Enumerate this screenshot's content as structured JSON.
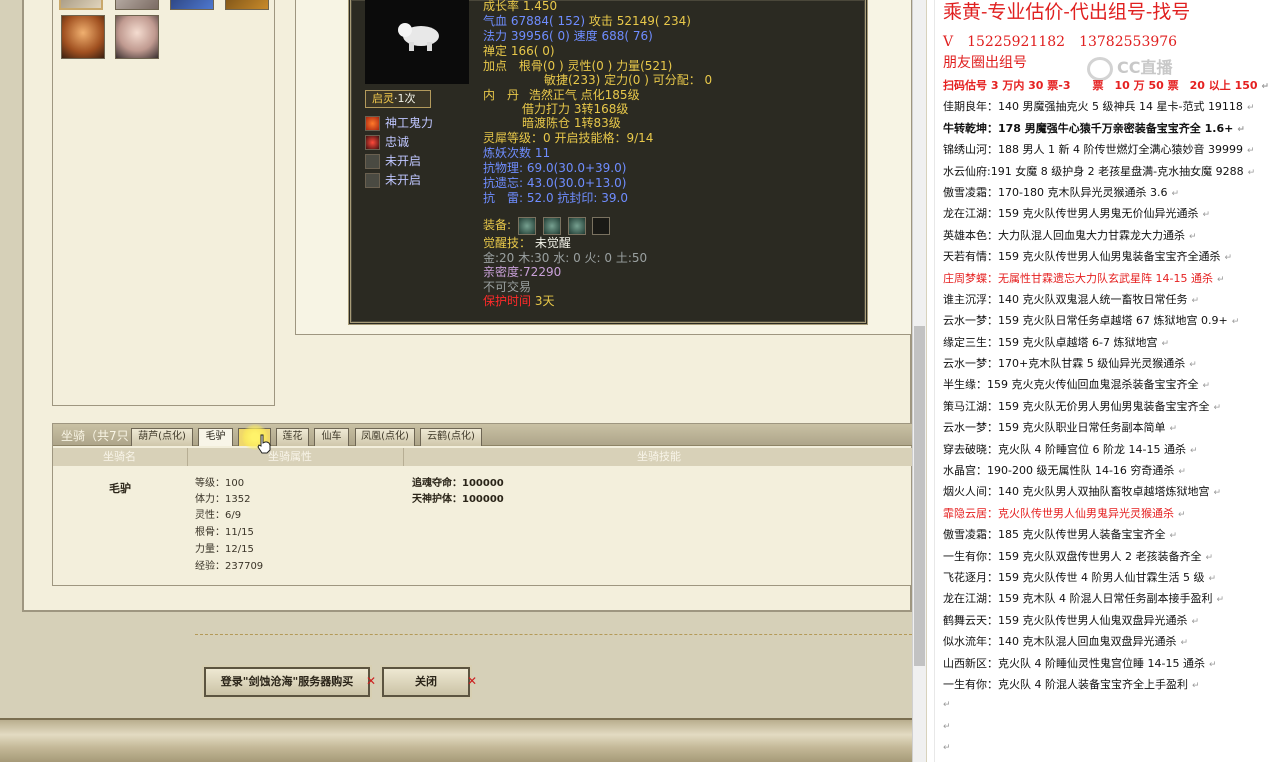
{
  "pet": {
    "growth_rate": "成长率 1.450",
    "hp": "气血 67884( 152)",
    "attack": "攻击 52149( 234)",
    "mp": "法力 39956( 0)",
    "speed": "速度 688( 76)",
    "zen": "禅定 166( 0)",
    "points_line1_label": "加点",
    "points_line1": "根骨(0 ) 灵性(0 ) 力量(521)",
    "points_line2": "敏捷(233) 定力(0 ) 可分配： 0",
    "inner_label": "内　丹",
    "inner_line1": "浩然正气 点化185级",
    "inner_line2": "借力打力 3转168级",
    "inner_line3": "暗渡陈仓 1转83级",
    "spirit_level": "灵犀等级：0 开启技能格：9/14",
    "refine_count": "炼妖次数 11",
    "resist_physical": "抗物理: 69.0(30.0+39.0)",
    "resist_forget": "抗遗忘: 43.0(30.0+13.0)",
    "resist_thunder": "抗　雷: 52.0 抗封印: 39.0",
    "equip_label": "装备:",
    "awaken_label": "觉醒技：",
    "awaken_value": "未觉醒",
    "elements": "金:20 木:30 水: 0 火: 0 土:50",
    "intimacy": "亲密度:72290",
    "not_tradable": "不可交易",
    "protect_label": "保护时间",
    "protect_value": "3天",
    "qiling_label": "启灵",
    "qiling_count": "1次",
    "skills": [
      "神工鬼力",
      "忠诚",
      "未开启",
      "未开启"
    ]
  },
  "mount": {
    "title": "坐骑（共7只",
    "tabs": [
      "葫芦(点化)",
      "毛驴",
      "",
      "莲花",
      "仙车",
      "凤凰(点化)",
      "云鹤(点化)"
    ],
    "col_name": "坐骑名",
    "col_attr": "坐骑属性",
    "col_skill": "坐骑技能",
    "name": "毛驴",
    "attrs": [
      "等级：100",
      "体力：1352",
      "灵性：6/9",
      "根骨：11/15",
      "力量：12/15",
      "经验：237709"
    ],
    "skills": [
      "追魂夺命：100000",
      "天神护体：100000"
    ]
  },
  "buttons": {
    "login_buy": "登录\"剑蚀沧海\"服务器购买",
    "close": "关闭"
  },
  "doc": {
    "header": "乘黄-专业估价-代出组号-找号",
    "phone": "V　15225921182　13782553976",
    "moments": "朋友圈出组号",
    "watermark": "CC直播",
    "lines": [
      {
        "text": "扫码估号 3 万内 30 票-3　　票　10 万 50 票　20 以上 150",
        "style": "redbold"
      },
      {
        "text": "佳期良年：140 男魔强抽克火 5 级神兵 14 星卡-范式 19118",
        "style": "normal"
      },
      {
        "text": "牛转乾坤：178 男魔强牛心猿千万亲密装备宝宝齐全 1.6+",
        "style": "bold"
      },
      {
        "text": "锦绣山河：188 男人 1 新 4 阶传世燃灯全满心猿妙音 39999",
        "style": "normal"
      },
      {
        "text": "水云仙府:191 女魔 8 级护身 2 老孩星盘满-克水抽女魔 9288",
        "style": "normal"
      },
      {
        "text": "傲雪凌霜：170-180 克木队异光灵猴通杀 3.6",
        "style": "normal"
      },
      {
        "text": "龙在江湖：159 克火队传世男人男鬼无价仙异光通杀",
        "style": "normal"
      },
      {
        "text": "英雄本色：大力队混人回血鬼大力甘霖龙大力通杀",
        "style": "normal"
      },
      {
        "text": "天若有情：159 克火队传世男人仙男鬼装备宝宝齐全通杀",
        "style": "normal"
      },
      {
        "text": "庄周梦蝶：无属性甘霖遗忘大力队玄武星阵 14-15 通杀",
        "style": "red"
      },
      {
        "text": "谁主沉浮：140 克火队双鬼混人统一畜牧日常任务",
        "style": "normal"
      },
      {
        "text": "云水一梦：159 克火队日常任务卓越塔 67 炼狱地宫 0.9+",
        "style": "normal"
      },
      {
        "text": "缘定三生：159 克火队卓越塔 6-7 炼狱地宫",
        "style": "normal"
      },
      {
        "text": "云水一梦：170+克木队甘霖 5 级仙异光灵猴通杀",
        "style": "normal"
      },
      {
        "text": "半生缘：159 克火克火传仙回血鬼混杀装备宝宝齐全",
        "style": "normal"
      },
      {
        "text": "策马江湖：159 克火队无价男人男仙男鬼装备宝宝齐全",
        "style": "normal"
      },
      {
        "text": "云水一梦：159 克火队职业日常任务副本简单",
        "style": "normal"
      },
      {
        "text": "穿去破晓：克火队 4 阶睡宫位 6 阶龙 14-15 通杀",
        "style": "normal"
      },
      {
        "text": "水晶宫：190-200 级无属性队 14-16 穷奇通杀",
        "style": "normal"
      },
      {
        "text": "烟火人间：140 克火队男人双抽队畜牧卓越塔炼狱地宫",
        "style": "normal"
      },
      {
        "text": "霏隐云居：克火队传世男人仙男鬼异光灵猴通杀",
        "style": "red"
      },
      {
        "text": "傲雪凌霜：185 克火队传世男人装备宝宝齐全",
        "style": "normal"
      },
      {
        "text": "一生有你：159 克火队双盘传世男人 2 老孩装备齐全",
        "style": "normal"
      },
      {
        "text": "飞花逐月：159 克火队传世 4 阶男人仙甘霖生活 5 级",
        "style": "normal"
      },
      {
        "text": "龙在江湖：159 克木队 4 阶混人日常任务副本接手盈利",
        "style": "normal"
      },
      {
        "text": "鹤舞云天：159 克火队传世男人仙鬼双盘异光通杀",
        "style": "normal"
      },
      {
        "text": "似水流年：140 克木队混人回血鬼双盘异光通杀",
        "style": "normal"
      },
      {
        "text": "山西新区：克火队 4 阶睡仙灵性鬼宫位睡 14-15 通杀",
        "style": "normal"
      },
      {
        "text": "一生有你：克火队 4 阶混人装备宝宝齐全上手盈利",
        "style": "normal"
      }
    ]
  },
  "colors": {
    "doc_red": "#e52020",
    "pet_yellow": "#e8c84a",
    "pet_blue": "#6f8dff",
    "panel_dark": "#2b2a22"
  }
}
